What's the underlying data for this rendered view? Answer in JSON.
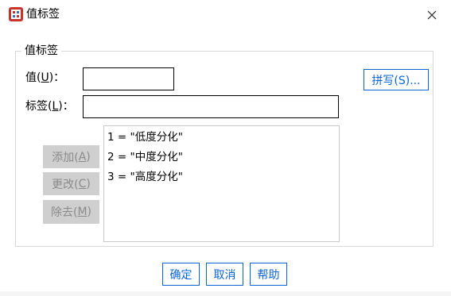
{
  "window": {
    "title": "值标签",
    "close_glyph": "✕",
    "app_icon": "spss-app-icon"
  },
  "group": {
    "legend": "值标签"
  },
  "value_field": {
    "label": "值(",
    "mnemonic": "U",
    "label_suffix": ")：",
    "value": ""
  },
  "label_field": {
    "label": "标签(",
    "mnemonic": "L",
    "label_suffix": ")：",
    "value": ""
  },
  "buttons": {
    "spell": {
      "text": "拼写(S)..."
    },
    "add": {
      "text": "添加(",
      "mnemonic": "A",
      "suffix": ")"
    },
    "change": {
      "text": "更改(",
      "mnemonic": "C",
      "suffix": ")"
    },
    "remove": {
      "text": "除去(",
      "mnemonic": "M",
      "suffix": ")"
    },
    "ok": "确定",
    "cancel": "取消",
    "help": "帮助"
  },
  "labels_list": [
    "1 = \"低度分化\"",
    "2 = \"中度分化\"",
    "3 = \"高度分化\""
  ],
  "colors": {
    "accent_blue": "#0a64d6",
    "disabled_bg": "#cfcfcf",
    "disabled_text": "#8a8a8a",
    "group_border": "#d8d8d8"
  }
}
